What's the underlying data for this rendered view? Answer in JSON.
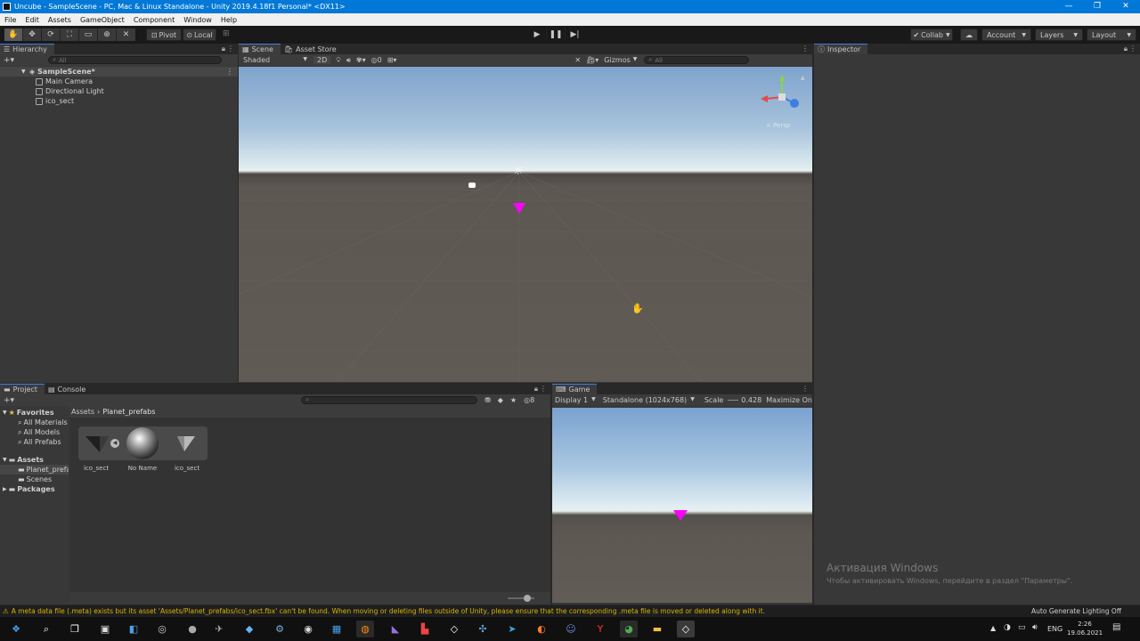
{
  "window": {
    "title": "Uncube - SampleScene - PC, Mac & Linux Standalone - Unity 2019.4.18f1 Personal* <DX11>",
    "controls": [
      "—",
      "❐",
      "✕"
    ]
  },
  "menu": [
    "File",
    "Edit",
    "Assets",
    "GameObject",
    "Component",
    "Window",
    "Help"
  ],
  "toolbar": {
    "pivot": "Pivot",
    "local": "Local",
    "collab": "Collab",
    "account": "Account",
    "layers": "Layers",
    "layout": "Layout"
  },
  "hierarchy": {
    "tab": "Hierarchy",
    "search_placeholder": "All",
    "scene": "SampleScene*",
    "items": [
      "Main Camera",
      "Directional Light",
      "ico_sect"
    ]
  },
  "scene": {
    "tabs": [
      "Scene",
      "Asset Store"
    ],
    "shading": "Shaded",
    "mode_2d": "2D",
    "hidden_count": "0",
    "gizmos": "Gizmos",
    "search_placeholder": "All",
    "persp_label": "< Persp"
  },
  "inspector": {
    "tab": "Inspector"
  },
  "project": {
    "tabs": [
      "Project",
      "Console"
    ],
    "favorites": {
      "label": "Favorites",
      "items": [
        "All Materials",
        "All Models",
        "All Prefabs"
      ]
    },
    "assets": {
      "label": "Assets",
      "items": [
        "Planet_prefabs",
        "Scenes"
      ]
    },
    "packages": "Packages",
    "breadcrumb": [
      "Assets",
      "Planet_prefabs"
    ],
    "hidden_count": "8",
    "files": [
      {
        "name": "ico_sect",
        "kind": "model"
      },
      {
        "name": "No Name",
        "kind": "material"
      },
      {
        "name": "ico_sect",
        "kind": "mesh"
      }
    ]
  },
  "game": {
    "tab": "Game",
    "display": "Display 1",
    "resolution": "Standalone (1024x768)",
    "scale_label": "Scale",
    "scale_value": "0.428",
    "maximize": "Maximize On"
  },
  "status": {
    "message": "A meta data file (.meta) exists but its asset 'Assets/Planet_prefabs/ico_sect.fbx' can't be found. When moving or deleting files outside of Unity, please ensure that the corresponding .meta file is moved or deleted along with it.",
    "lighting": "Auto Generate Lighting Off"
  },
  "watermark": {
    "title": "Активация Windows",
    "subtitle": "Чтобы активировать Windows, перейдите в раздел \"Параметры\"."
  },
  "taskbar": {
    "lang": "ENG",
    "time": "2:26",
    "date": "19.06.2021"
  },
  "colors": {
    "accent": "#0078d7",
    "magenta_object": "#ff00ff",
    "warning": "#d8b400"
  }
}
